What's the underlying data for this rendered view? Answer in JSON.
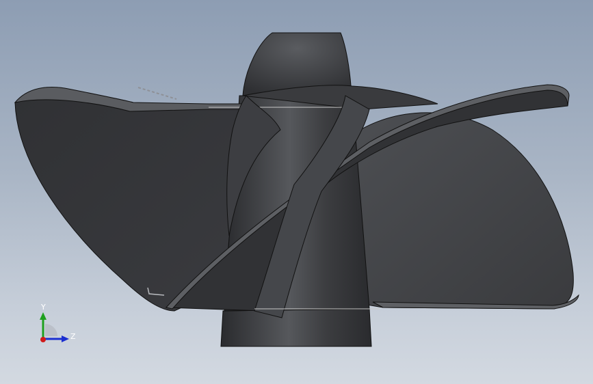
{
  "viewport": {
    "model_name": "propeller-impeller",
    "colors": {
      "background_top": "#8d9db3",
      "background_bottom": "#d3d9e1",
      "model_dark": "#2f3033",
      "model_mid": "#404145",
      "model_light": "#55575b",
      "edge_line": "#111111"
    }
  },
  "triad": {
    "y_label": "Y",
    "z_label": "Z",
    "colors": {
      "y_axis": "#1ea01e",
      "z_axis": "#1a2ed0",
      "x_axis": "#d01a1a"
    }
  }
}
